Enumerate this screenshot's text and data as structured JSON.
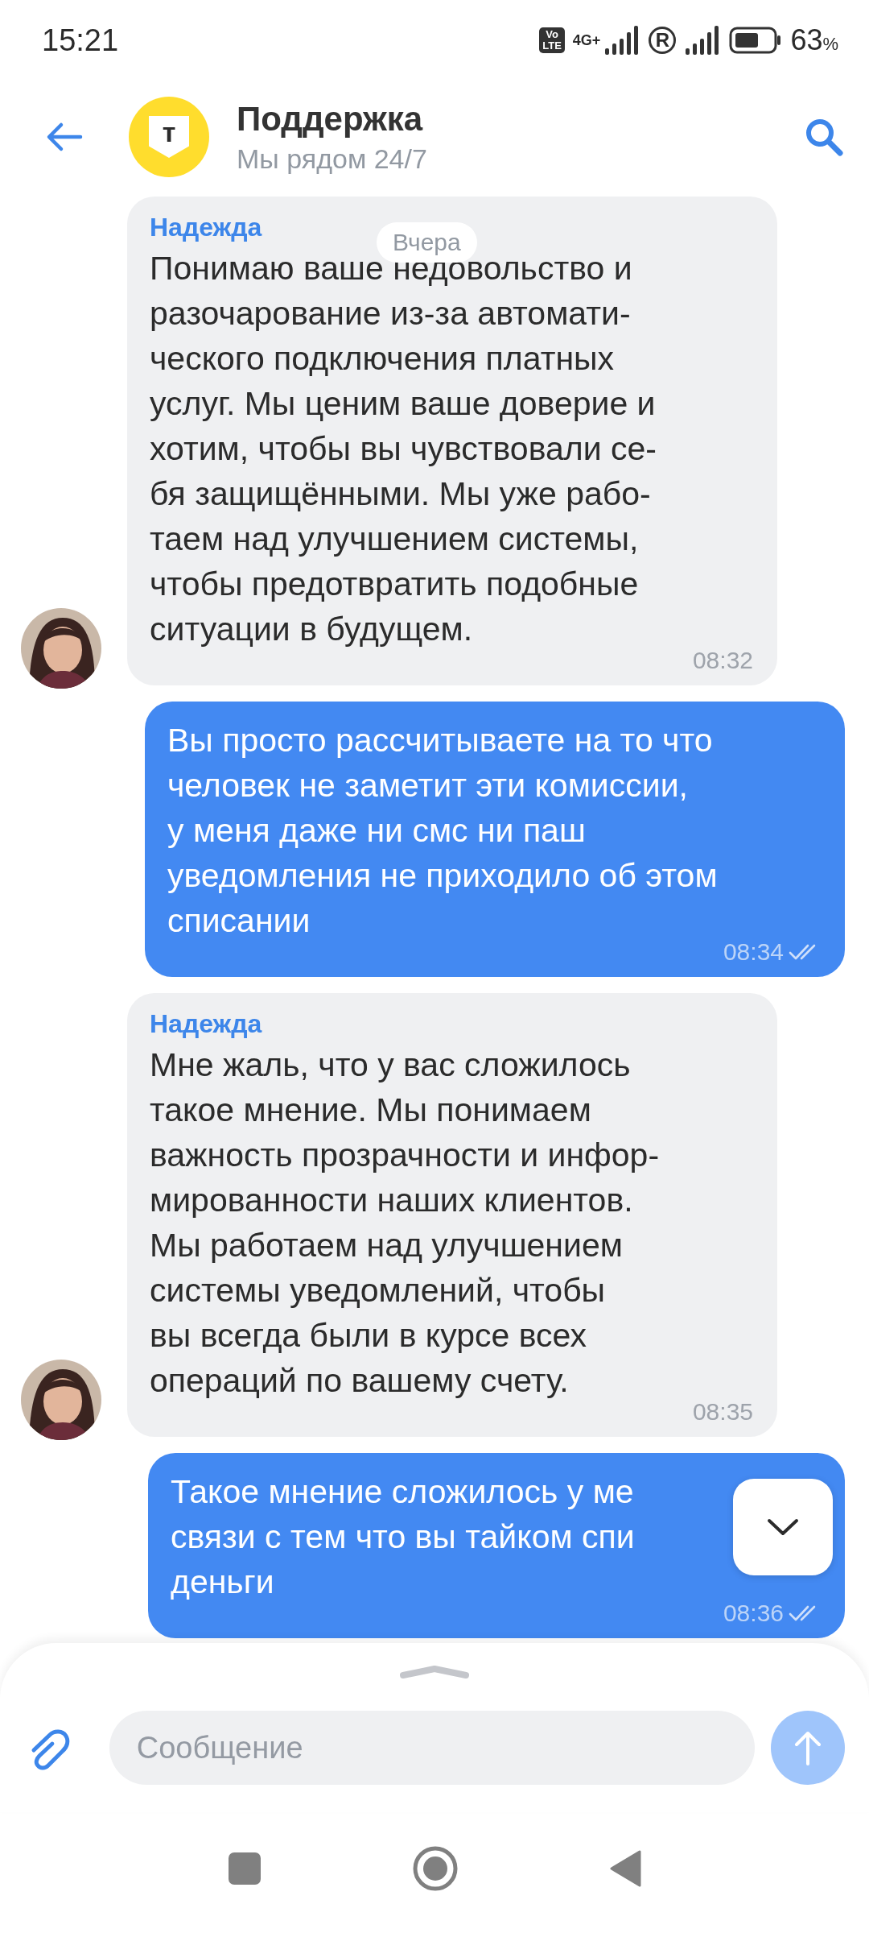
{
  "status_bar": {
    "time": "15:21",
    "volte": [
      "Vo",
      "LTE"
    ],
    "network": "4G+",
    "roaming": "R",
    "battery": "63",
    "battery_unit": "%"
  },
  "header": {
    "title": "Поддержка",
    "subtitle": "Мы рядом 24/7",
    "logo_letter": "т"
  },
  "date_chip": "Вчера",
  "messages": [
    {
      "kind": "incoming",
      "author": "Надежда",
      "lines": [
        "Понимаю ваше недовольство и",
        "разочарование из-за автомати-",
        "ческого подключения платных",
        "услуг. Мы ценим ваше доверие и",
        "хотим, чтобы вы чувствовали се-",
        "бя защищёнными. Мы уже рабо-",
        "таем над улучшением системы,",
        "чтобы предотвратить подобные",
        "ситуации в будущем."
      ],
      "time": "08:32"
    },
    {
      "kind": "outgoing",
      "lines": [
        "Вы просто рассчитываете на то что",
        "человек не заметит эти комиссии,",
        "у меня даже ни смс ни паш",
        "уведомления не приходило об этом",
        "списании"
      ],
      "time": "08:34",
      "read": true
    },
    {
      "kind": "incoming",
      "author": "Надежда",
      "lines": [
        "Мне жаль, что у вас сложилось",
        "такое мнение. Мы понимаем",
        "важность прозрачности и инфор-",
        "мированности наших клиентов.",
        "Мы работаем над улучшением",
        "системы уведомлений, чтобы",
        "вы всегда были в курсе всех",
        "операций по вашему счету."
      ],
      "time": "08:35"
    },
    {
      "kind": "outgoing",
      "lines": [
        "Такое мнение сложилось у ме",
        "связи с тем что вы тайком спи",
        "деньги"
      ],
      "time": "08:36",
      "read": true
    }
  ],
  "composer": {
    "placeholder": "Сообщение"
  }
}
